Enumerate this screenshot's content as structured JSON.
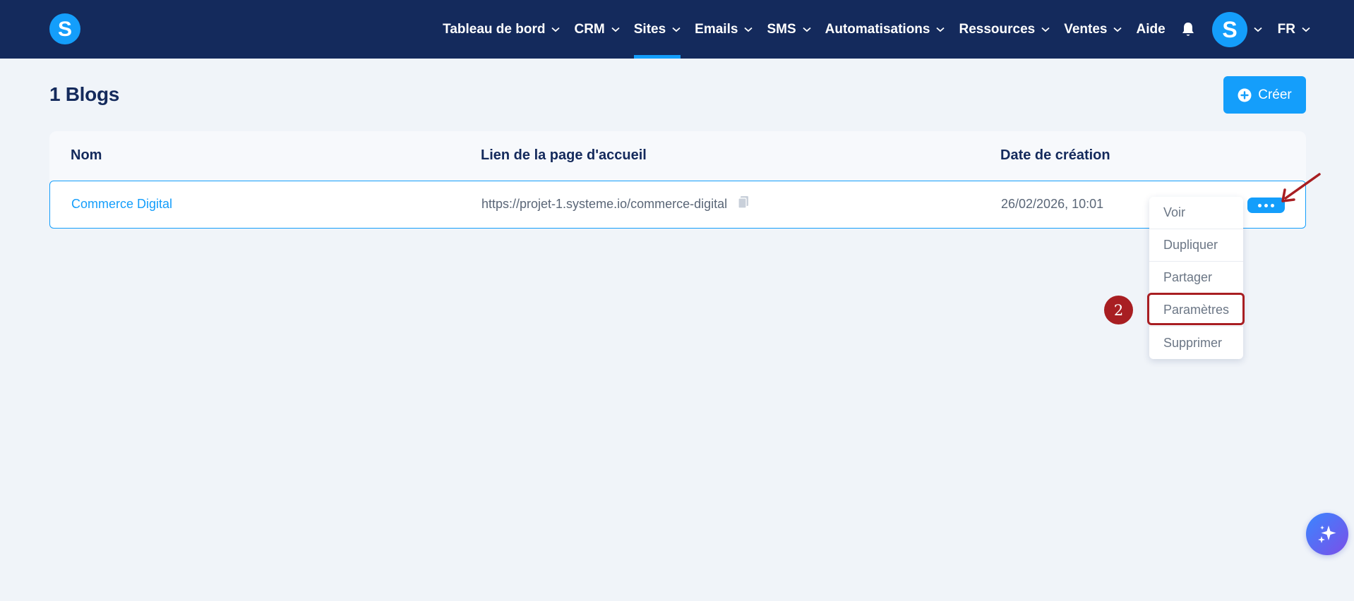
{
  "app": {
    "logo_letter": "S",
    "brand_color": "#149efb",
    "header_color": "#142a5c"
  },
  "nav": {
    "items": [
      {
        "label": "Tableau de bord",
        "has_dropdown": true,
        "active": false
      },
      {
        "label": "CRM",
        "has_dropdown": true,
        "active": false
      },
      {
        "label": "Sites",
        "has_dropdown": true,
        "active": true
      },
      {
        "label": "Emails",
        "has_dropdown": true,
        "active": false
      },
      {
        "label": "SMS",
        "has_dropdown": true,
        "active": false
      },
      {
        "label": "Automatisations",
        "has_dropdown": true,
        "active": false
      },
      {
        "label": "Ressources",
        "has_dropdown": true,
        "active": false
      },
      {
        "label": "Ventes",
        "has_dropdown": true,
        "active": false
      },
      {
        "label": "Aide",
        "has_dropdown": false,
        "active": false
      }
    ],
    "notification_icon": "bell-icon",
    "avatar_letter": "S",
    "language": "FR"
  },
  "page": {
    "title": "1 Blogs",
    "create_button_label": "Créer",
    "create_button_icon": "plus-circle-icon"
  },
  "table": {
    "headers": [
      "Nom",
      "Lien de la page d'accueil",
      "Date de création"
    ],
    "rows": [
      {
        "name": "Commerce Digital",
        "link": "https://projet-1.systeme.io/commerce-digital",
        "date": "26/02/2026, 10:01"
      }
    ]
  },
  "row_menu": {
    "items": [
      "Voir",
      "Dupliquer",
      "Partager",
      "Paramètres",
      "Supprimer"
    ],
    "highlighted_item": "Paramètres"
  },
  "annotations": {
    "step_number": "2",
    "annotation_color": "#a81e22"
  }
}
